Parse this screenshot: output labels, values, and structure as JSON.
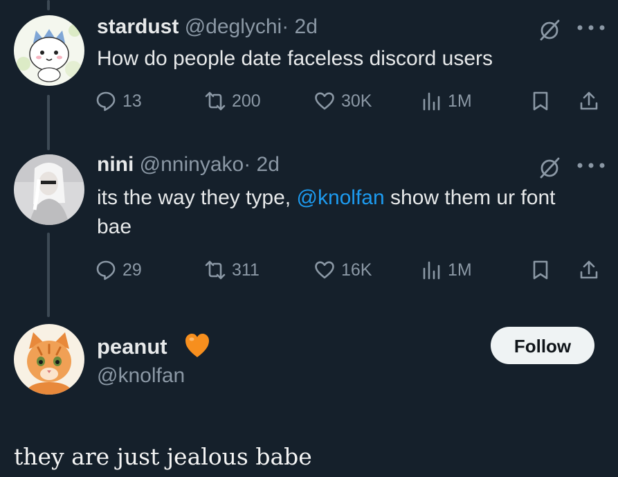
{
  "tweets": [
    {
      "display_name": "stardust",
      "handle": "@deglychi",
      "time": "· 2d",
      "text": "How do people date faceless discord users",
      "stats": {
        "replies": "13",
        "reposts": "200",
        "likes": "30K",
        "views": "1M"
      },
      "avatar_icon": "chiikawa-cartoon-avatar"
    },
    {
      "display_name": "nini",
      "handle": "@nninyako",
      "time": "· 2d",
      "text_before": "its the way they type, ",
      "mention": "@knolfan",
      "text_after": " show them ur font bae",
      "stats": {
        "replies": "29",
        "reposts": "311",
        "likes": "16K",
        "views": "1M"
      },
      "avatar_icon": "white-haired-figure-avatar"
    }
  ],
  "profile": {
    "display_name": "peanut",
    "handle": "@knolfan",
    "emoji": "orange-heart",
    "follow_label": "Follow",
    "avatar_icon": "orange-kitten-avatar"
  },
  "caption": "they are just jealous babe",
  "colors": {
    "background": "#15202b",
    "text": "#e7e9ea",
    "muted": "#8b98a5",
    "link": "#1d9bf0",
    "follow_bg": "#eff3f4",
    "heart": "#f78f1e"
  },
  "icons": [
    "reply-icon",
    "repost-icon",
    "like-icon",
    "views-icon",
    "bookmark-icon",
    "share-icon",
    "grok-icon",
    "more-icon"
  ]
}
